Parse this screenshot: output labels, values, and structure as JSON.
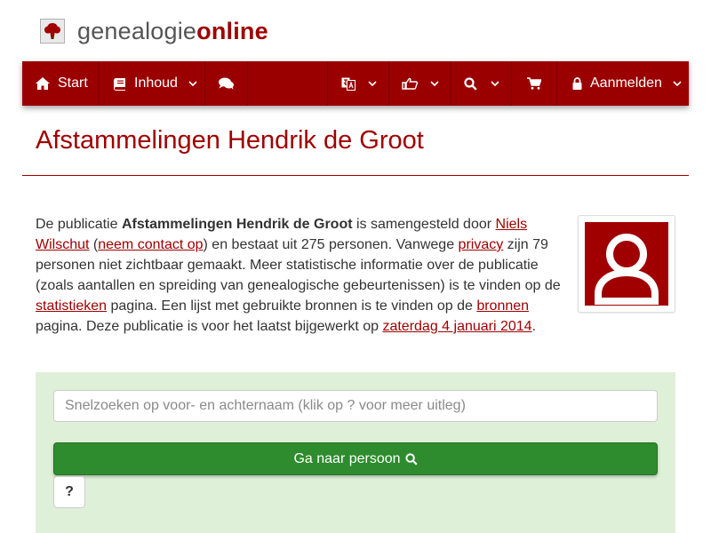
{
  "header": {
    "logo_icon": "tree-icon",
    "logo_text_plain": "genealogie",
    "logo_text_accent": "online"
  },
  "navbar": {
    "start_label": "Start",
    "inhoud_label": "Inhoud",
    "login_label": "Aanmelden",
    "icons": {
      "start": "home-icon",
      "inhoud": "book-icon",
      "chat": "comments-icon",
      "language": "language-icon",
      "share": "hand-pointer-icon",
      "search": "search-icon",
      "cart": "shopping-cart-icon",
      "login": "lock-icon"
    }
  },
  "page": {
    "title": "Afstammelingen Hendrik de Groot"
  },
  "intro": {
    "t1": "De publicatie ",
    "pub_name": "Afstammelingen Hendrik de Groot",
    "t2": " is samengesteld door ",
    "author": "Niels Wilschut",
    "t3": " (",
    "contact": "neem contact op",
    "t4": ") en bestaat uit 275 personen. Vanwege ",
    "privacy": "privacy",
    "t5": " zijn 79 personen niet zichtbaar gemaakt. Meer statistische informatie over de publicatie (zoals aantallen en spreiding van genealogische gebeurtenissen) is te vinden op de ",
    "stats": "statistieken",
    "t6": " pagina. Een lijst met gebruikte bronnen is te vinden op de ",
    "sources": "bronnen",
    "t7": " pagina. Deze publicatie is voor het laatst bijgewerkt op ",
    "updated": "zaterdag 4 januari 2014",
    "t8": "."
  },
  "search": {
    "placeholder": "Snelzoeken op voor- en achternaam (klik op ? voor meer uitleg)",
    "button_label": "Ga naar persoon",
    "help_label": "?"
  },
  "colors": {
    "brand": "#a00000",
    "navbar": "#9b0000",
    "panel": "#dff0d8",
    "button": "#2e8b2e"
  }
}
